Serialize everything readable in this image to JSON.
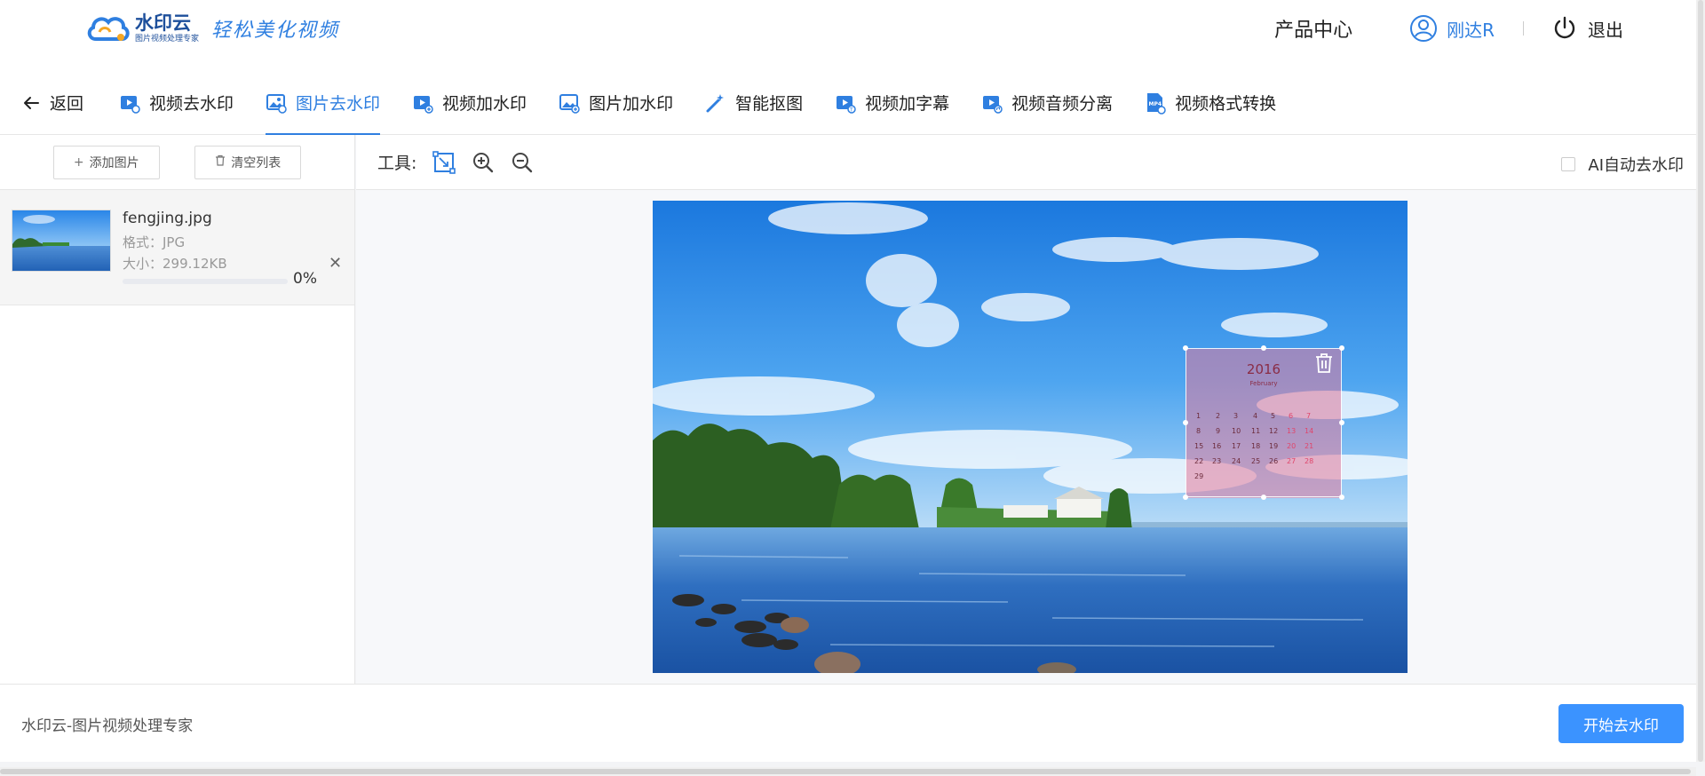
{
  "header": {
    "logo_name": "水印云",
    "logo_sub": "图片视频处理专家",
    "slogan": "轻松美化视频",
    "product_center": "产品中心",
    "username": "刚达R",
    "logout": "退出"
  },
  "nav": {
    "back": "返回",
    "items": [
      {
        "label": "视频去水印",
        "icon": "video-icon"
      },
      {
        "label": "图片去水印",
        "icon": "image-icon",
        "active": true
      },
      {
        "label": "视频加水印",
        "icon": "video-add-icon"
      },
      {
        "label": "图片加水印",
        "icon": "image-add-icon"
      },
      {
        "label": "智能抠图",
        "icon": "magic-wand-icon"
      },
      {
        "label": "视频加字幕",
        "icon": "subtitle-icon"
      },
      {
        "label": "视频音频分离",
        "icon": "audio-split-icon"
      },
      {
        "label": "视频格式转换",
        "icon": "mp4-icon"
      }
    ]
  },
  "left_panel": {
    "add_button": "添加图片",
    "clear_button": "清空列表",
    "files": [
      {
        "name": "fengjing.jpg",
        "format": "格式：JPG",
        "size": "大小：299.12KB",
        "progress": 0,
        "progress_text": "0%"
      }
    ]
  },
  "toolbar": {
    "label": "工具:",
    "ai_auto": "AI自动去水印"
  },
  "selection": {
    "calendar_year": "2016",
    "calendar_month": "February"
  },
  "footer": {
    "text": "水印云-图片视频处理专家",
    "start_button": "开始去水印"
  },
  "colors": {
    "accent": "#2f7fe0",
    "primary_button": "#3b93ff"
  }
}
